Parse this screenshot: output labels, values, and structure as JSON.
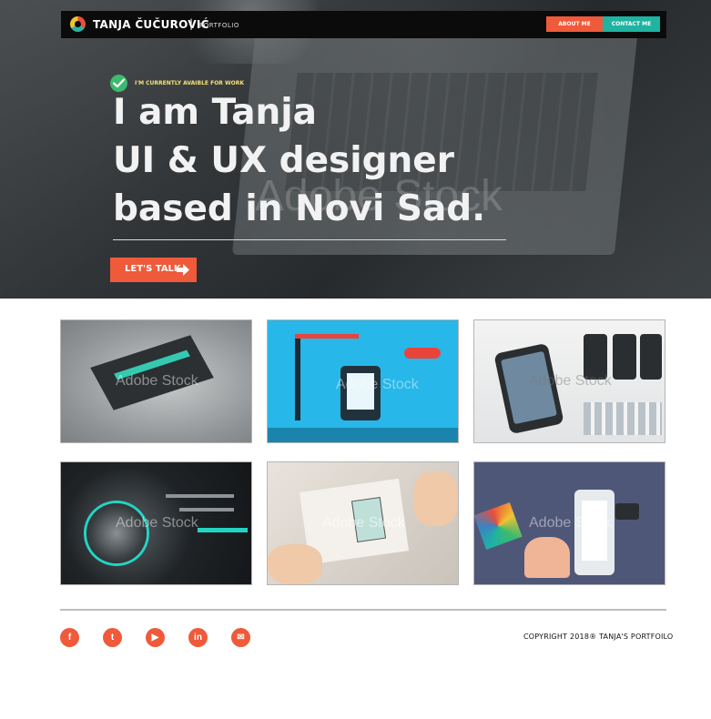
{
  "navbar": {
    "brand_name": "TANJA ČUČUROVIĆ",
    "brand_separator": "|",
    "brand_subtitle": "PORTFOLIO",
    "about_label": "ABOUT ME",
    "contact_label": "CONTACT ME"
  },
  "hero": {
    "availability": "I'M CURRENTLY AVAIBLE FOR WORK",
    "headline_line1": "I am Tanja",
    "headline_line2": "UI & UX designer",
    "headline_line3": "based in Novi Sad.",
    "cta_label": "LET'S TALK",
    "watermark": "Adobe Stock"
  },
  "portfolio": {
    "tile_watermark": "Adobe Stock",
    "tiles": [
      {
        "icon": "isometric-app-image"
      },
      {
        "icon": "app-construction-image"
      },
      {
        "icon": "smartphone-mockup-image"
      },
      {
        "icon": "ux-knob-image"
      },
      {
        "icon": "wireframe-sketch-image"
      },
      {
        "icon": "mobile-design-image"
      }
    ]
  },
  "footer": {
    "social": [
      {
        "icon": "facebook-icon",
        "glyph": "f"
      },
      {
        "icon": "twitter-icon",
        "glyph": "t"
      },
      {
        "icon": "youtube-icon",
        "glyph": "▶"
      },
      {
        "icon": "linkedin-icon",
        "glyph": "in"
      },
      {
        "icon": "mail-icon",
        "glyph": "✉"
      }
    ],
    "copyright": "COPYRIGHT 2018® TANJA'S PORTFOILO"
  },
  "colors": {
    "accent_orange": "#ef5a3a",
    "accent_teal": "#1fb3a1",
    "check_green": "#3cba6d"
  }
}
